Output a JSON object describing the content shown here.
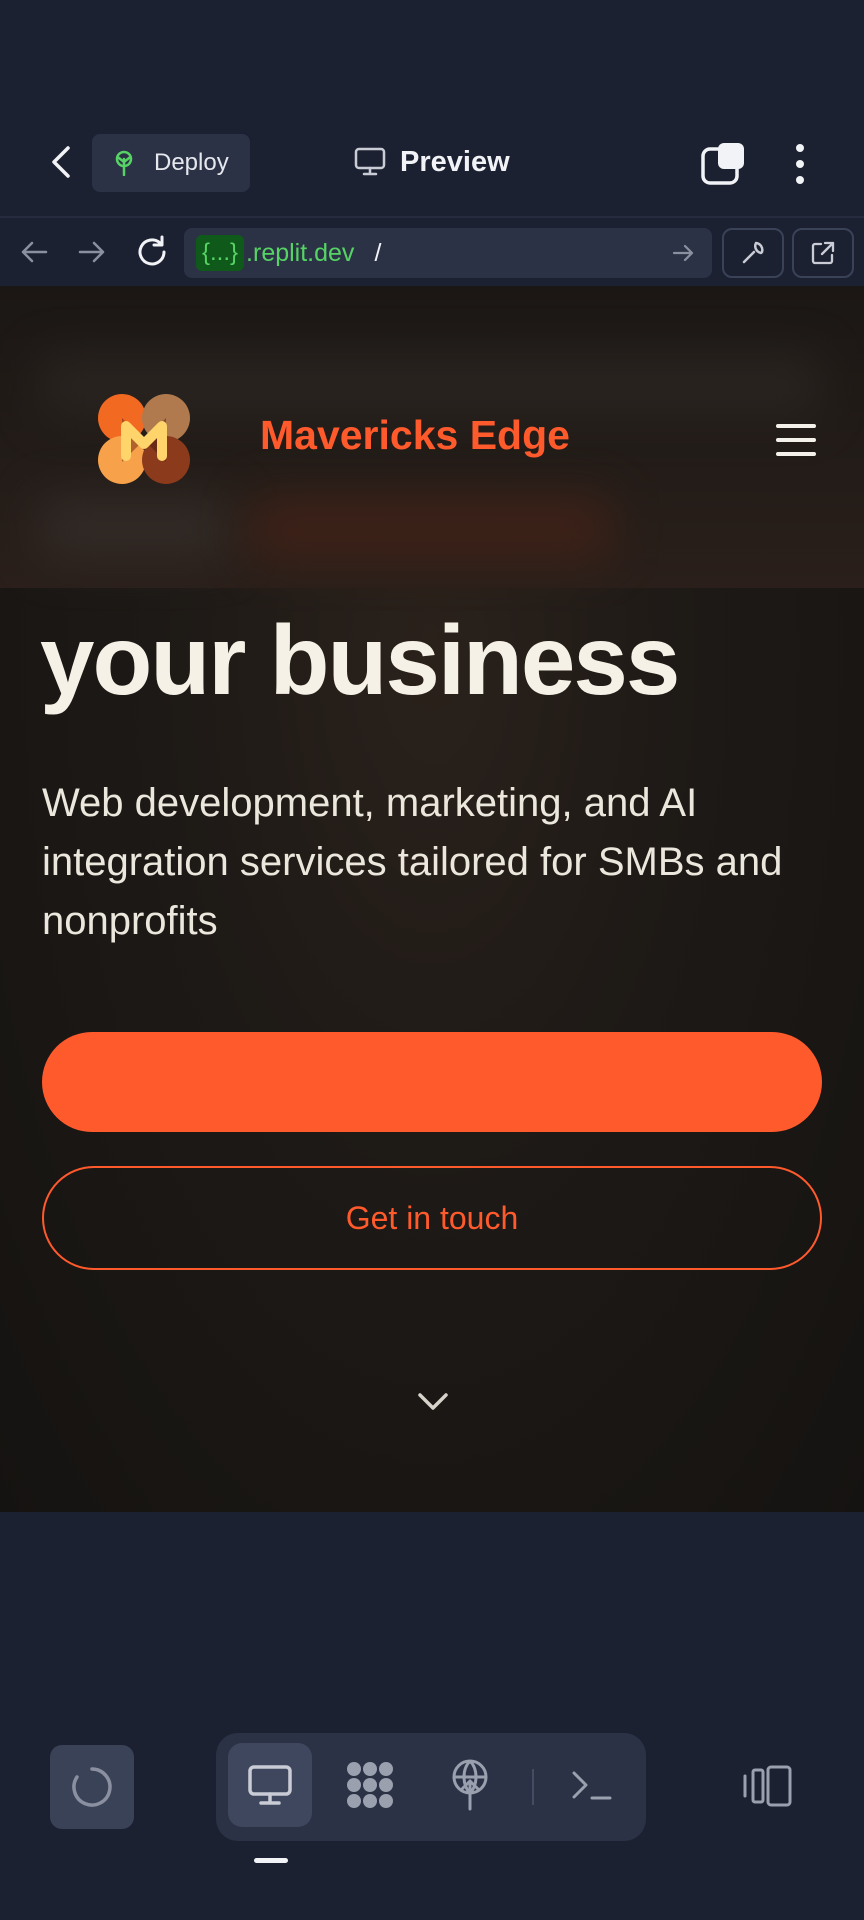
{
  "toolbar": {
    "deploy_label": "Deploy",
    "preview_label": "Preview"
  },
  "urlbar": {
    "placeholder_token": "{...}",
    "domain": ".replit.dev",
    "path": "/"
  },
  "site": {
    "brand_name": "Mavericks Edge",
    "headline": "your business",
    "subheadline": "Web development, marketing, and AI integration services tailored for SMBs and nonprofits",
    "primary_cta_label": "",
    "secondary_cta_label": "Get in touch"
  },
  "colors": {
    "accent": "#ff5a2c",
    "ide_background": "#1c2132",
    "url_green": "#56d364"
  },
  "icons": {
    "toolbar": [
      "chevron-left-icon",
      "deploy-icon",
      "monitor-icon",
      "tabs-icon",
      "kebab-icon"
    ],
    "urlbar": [
      "arrow-left-icon",
      "arrow-right-icon",
      "reload-icon",
      "arrow-right-icon",
      "wrench-icon",
      "external-link-icon"
    ],
    "dock": [
      "spinner-icon",
      "monitor-icon",
      "agent-icon",
      "deployments-icon",
      "terminal-icon",
      "panels-icon"
    ]
  }
}
